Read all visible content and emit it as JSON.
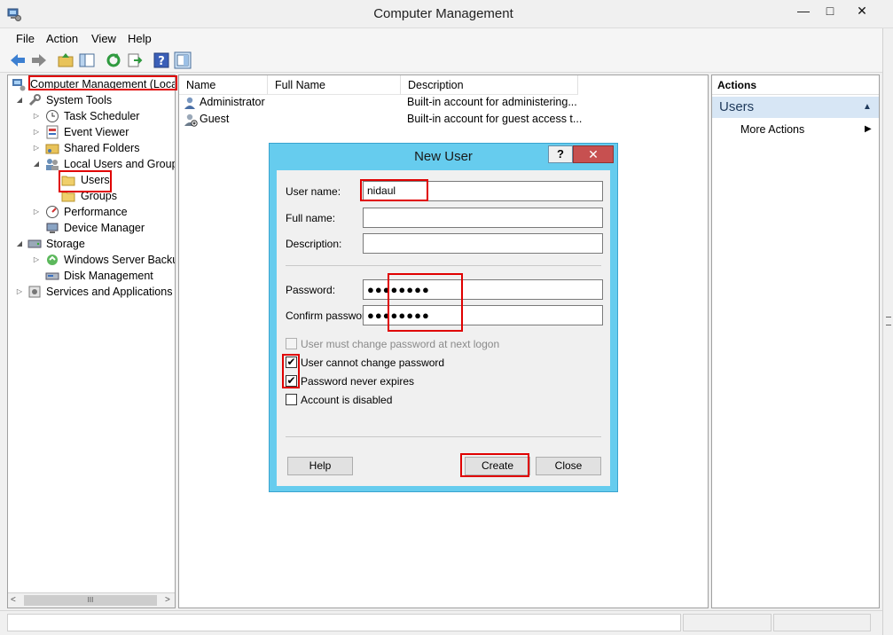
{
  "window": {
    "title": "Computer Management",
    "min_glyph": "—",
    "max_glyph": "□",
    "close_glyph": "✕"
  },
  "menu": [
    "File",
    "Action",
    "View",
    "Help"
  ],
  "tree": {
    "root": "Computer Management (Local",
    "items": [
      {
        "label": "System Tools"
      },
      {
        "label": "Task Scheduler"
      },
      {
        "label": "Event Viewer"
      },
      {
        "label": "Shared Folders"
      },
      {
        "label": "Local Users and Groups"
      },
      {
        "label": "Users"
      },
      {
        "label": "Groups"
      },
      {
        "label": "Performance"
      },
      {
        "label": "Device Manager"
      },
      {
        "label": "Storage"
      },
      {
        "label": "Windows Server Backup"
      },
      {
        "label": "Disk Management"
      },
      {
        "label": "Services and Applications"
      }
    ],
    "hscroll_thumb": "III"
  },
  "list": {
    "columns": [
      "Name",
      "Full Name",
      "Description"
    ],
    "rows": [
      {
        "name": "Administrator",
        "full_name": "",
        "description": "Built-in account for administering..."
      },
      {
        "name": "Guest",
        "full_name": "",
        "description": "Built-in account for guest access t..."
      }
    ]
  },
  "actions": {
    "header": "Actions",
    "section": "Users",
    "section_glyph": "▲",
    "more": "More Actions",
    "more_glyph": "▶"
  },
  "dialog": {
    "title": "New User",
    "help_glyph": "?",
    "close_glyph": "✕",
    "user_name_label": "User name:",
    "user_name_value": "nidaul",
    "full_name_label": "Full name:",
    "full_name_value": "",
    "description_label": "Description:",
    "description_value": "",
    "password_label": "Password:",
    "password_value": "●●●●●●●●",
    "confirm_label": "Confirm password:",
    "confirm_value": "●●●●●●●●",
    "checkboxes": [
      {
        "label": "User must change password at next logon",
        "checked": false,
        "disabled": true
      },
      {
        "label": "User cannot change password",
        "checked": true,
        "disabled": false
      },
      {
        "label": "Password never expires",
        "checked": true,
        "disabled": false
      },
      {
        "label": "Account is disabled",
        "checked": false,
        "disabled": false
      }
    ],
    "check_glyph": "✔",
    "buttons": {
      "help": "Help",
      "create": "Create",
      "close": "Close"
    }
  },
  "colors": {
    "dialog_frame": "#66ccee",
    "close_button": "#c75050",
    "annotation": "#e00000",
    "actions_section": "#d7e6f5"
  }
}
